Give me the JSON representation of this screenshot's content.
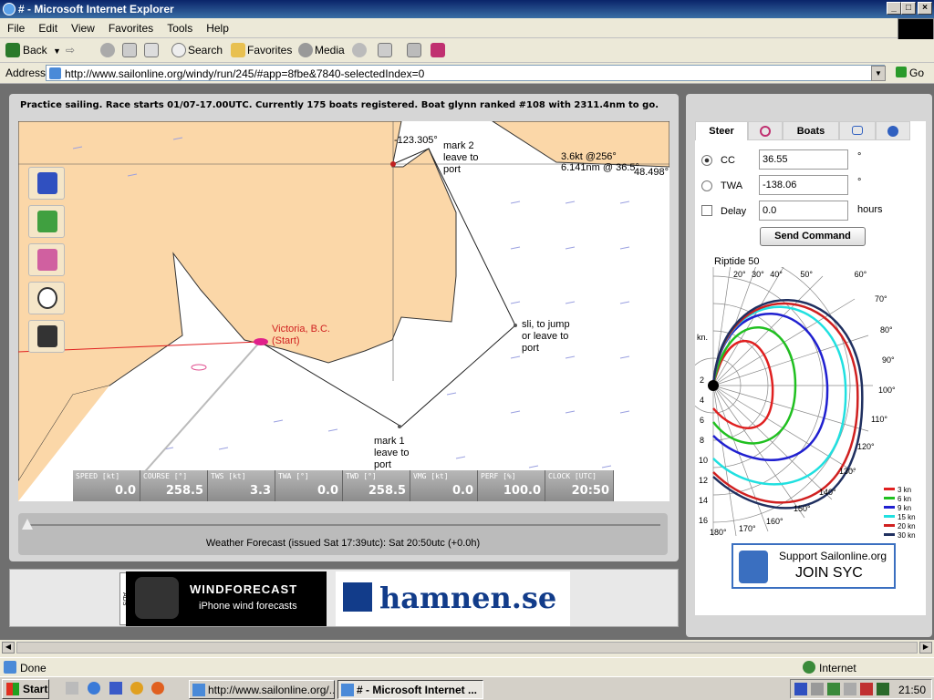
{
  "window": {
    "title": "# - Microsoft Internet Explorer",
    "min": "_",
    "max": "□",
    "close": "×"
  },
  "menu": [
    "File",
    "Edit",
    "View",
    "Favorites",
    "Tools",
    "Help"
  ],
  "toolbar": {
    "back": "Back",
    "search": "Search",
    "favorites": "Favorites",
    "media": "Media"
  },
  "address": {
    "label": "Address",
    "url": "http://www.sailonline.org/windy/run/245/#app=8fbe&7840-selectedIndex=0",
    "go": "Go"
  },
  "race_status": "Practice sailing. Race starts 01/07-17.00UTC. Currently 175 boats registered. Boat glynn ranked #108 with 2311.4nm to go.",
  "map": {
    "lon": "-123.305°",
    "lat": "48.498°",
    "wind": "3.6kt @256°",
    "dist": "6.141nm @ 36.5°",
    "mark2": [
      "mark 2",
      "leave to",
      "port"
    ],
    "mark1": [
      "mark 1",
      "leave to",
      "port"
    ],
    "sli": [
      "sli, to jump",
      "or leave to",
      "port"
    ],
    "start": [
      "Victoria, B.C.",
      "(Start)"
    ]
  },
  "instruments": [
    {
      "label": "SPEED [kt]",
      "value": "0.0"
    },
    {
      "label": "COURSE [°]",
      "value": "258.5"
    },
    {
      "label": "TWS [kt]",
      "value": "3.3"
    },
    {
      "label": "TWA [°]",
      "value": "0.0"
    },
    {
      "label": "TWD [°]",
      "value": "258.5"
    },
    {
      "label": "VMG [kt]",
      "value": "0.0"
    },
    {
      "label": "PERF [%]",
      "value": "100.0"
    },
    {
      "label": "CLOCK [UTC]",
      "value": "20:50"
    }
  ],
  "forecast": "Weather Forecast  (issued Sat 17:39utc): Sat 20:50utc  (+0.0h)",
  "banner": {
    "wf_title": "WINDFORECAST",
    "wf_sub": "iPhone wind forecasts",
    "ads": "ADS",
    "hamnen": "hamnen.se"
  },
  "steer": {
    "tabs": [
      "Steer",
      "Boats"
    ],
    "cc_label": "CC",
    "cc_value": "36.55",
    "cc_unit": "°",
    "twa_label": "TWA",
    "twa_value": "-138.06",
    "twa_unit": "°",
    "delay_label": "Delay",
    "delay_value": "0.0",
    "delay_unit": "hours",
    "send": "Send Command"
  },
  "polar": {
    "title": "Riptide 50",
    "kn": "kn.",
    "angles_top": [
      "20°",
      "30°",
      "40°",
      "50°",
      "60°"
    ],
    "angles_right": [
      "70°",
      "80°",
      "90°",
      "100°",
      "110°",
      "120°",
      "130°",
      "140°",
      "150°",
      "160°",
      "170°",
      "180°"
    ],
    "speeds": [
      "2",
      "4",
      "6",
      "8",
      "10",
      "12",
      "14",
      "16"
    ],
    "legend": [
      {
        "label": "3 kn",
        "color": "#e02020"
      },
      {
        "label": "6 kn",
        "color": "#20c020"
      },
      {
        "label": "9 kn",
        "color": "#2020d0"
      },
      {
        "label": "15 kn",
        "color": "#20e0e0"
      },
      {
        "label": "20 kn",
        "color": "#d02020"
      },
      {
        "label": "30 kn",
        "color": "#203060"
      }
    ]
  },
  "syc": {
    "line1": "Support Sailonline.org",
    "line2": "JOIN SYC"
  },
  "statusbar": {
    "done": "Done",
    "zone": "Internet"
  },
  "taskbar": {
    "start": "Start",
    "task1": "http://www.sailonline.org/...",
    "task2": "# - Microsoft Internet ...",
    "clock": "21:50"
  }
}
